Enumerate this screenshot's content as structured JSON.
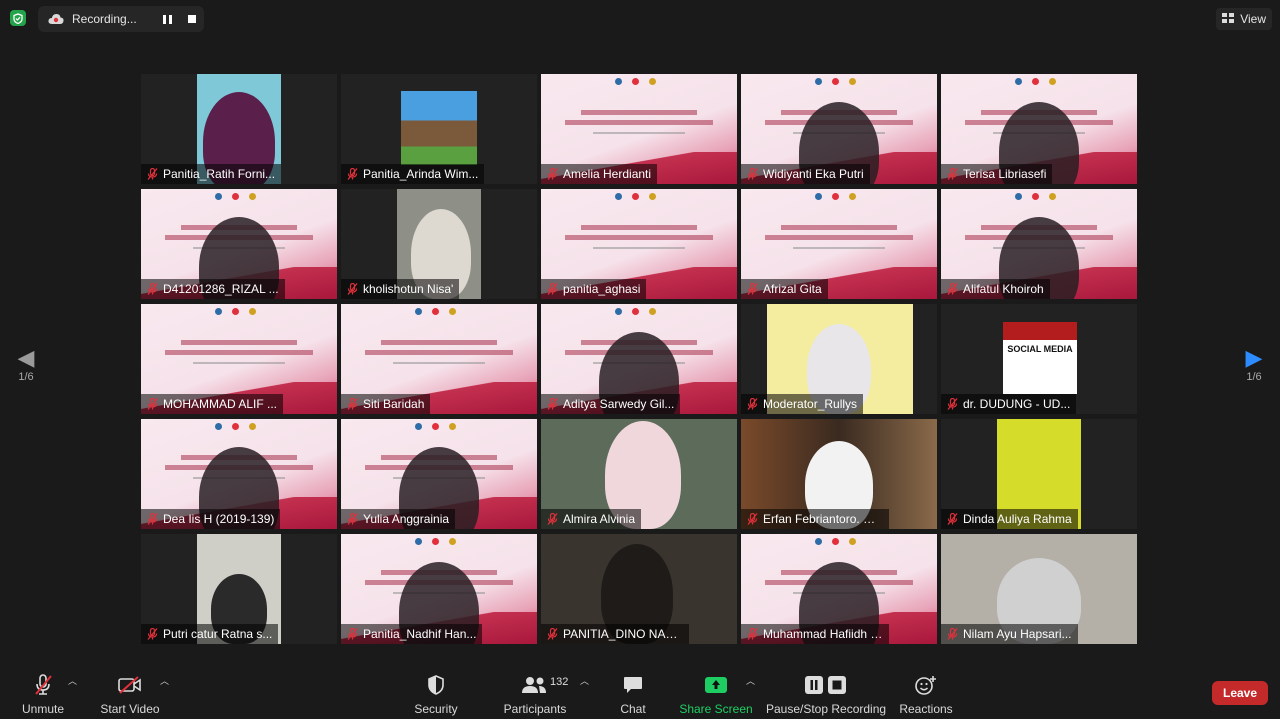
{
  "topbar": {
    "recording_label": "Recording...",
    "view_label": "View"
  },
  "pagination": {
    "left": "1/6",
    "right": "1/6"
  },
  "participants": [
    {
      "name": "Panitia_Ratih Forni..."
    },
    {
      "name": "Panitia_Arinda Wim..."
    },
    {
      "name": "Amelia Herdianti"
    },
    {
      "name": "Widiyanti Eka Putri"
    },
    {
      "name": "Terisa Libriasefi"
    },
    {
      "name": "D41201286_RIZAL ..."
    },
    {
      "name": "kholishotun Nisa'"
    },
    {
      "name": "panitia_aghasi"
    },
    {
      "name": "Afrizal Gita"
    },
    {
      "name": "Alifatul Khoiroh"
    },
    {
      "name": "MOHAMMAD ALIF ..."
    },
    {
      "name": "Siti Baridah"
    },
    {
      "name": "Aditya Sarwedy Gil..."
    },
    {
      "name": "Moderator_Rullys"
    },
    {
      "name": "dr. DUDUNG - UD..."
    },
    {
      "name": "Dea Iis H (2019-139)"
    },
    {
      "name": "Yulia Anggrainia"
    },
    {
      "name": "Almira Alvinia"
    },
    {
      "name": "Erfan Febriantoro. S.K..."
    },
    {
      "name": "Dinda Auliya Rahma"
    },
    {
      "name": "Putri catur Ratna s..."
    },
    {
      "name": "Panitia_Nadhif Han..."
    },
    {
      "name": "PANITIA_DINO NAB..."
    },
    {
      "name": "Muhammad Hafiidh N..."
    },
    {
      "name": "Nilam Ayu Hapsari..."
    }
  ],
  "social_media_label": "SOCIAL MEDIA",
  "toolbar": {
    "unmute": "Unmute",
    "start_video": "Start Video",
    "security": "Security",
    "participants": "Participants",
    "participants_count": "132",
    "chat": "Chat",
    "share_screen": "Share Screen",
    "recording": "Pause/Stop Recording",
    "reactions": "Reactions",
    "leave": "Leave"
  },
  "colors": {
    "accent_green": "#23a34a",
    "share_green": "#1fce63",
    "leave_red": "#c42a2a",
    "active_speaker": "#c8e06b",
    "nav_blue": "#2d8cff"
  }
}
